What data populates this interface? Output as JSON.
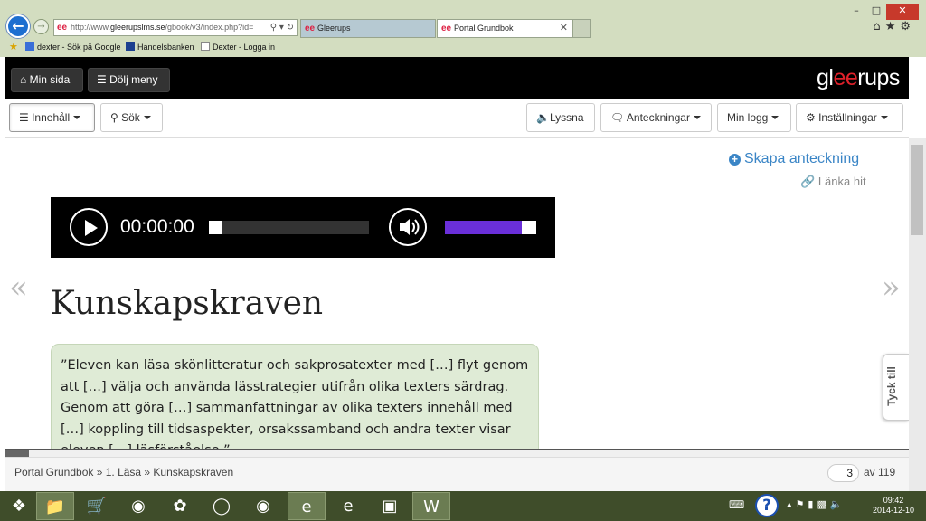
{
  "browser": {
    "url_prefix": "http://www.",
    "url_domain": "gleerupslms.se",
    "url_rest": "/gbook/v3/index.php?id=",
    "tabs": [
      {
        "label": "Gleerups"
      },
      {
        "label": "Portal Grundbok"
      }
    ],
    "favorites": [
      {
        "label": "dexter - Sök på Google"
      },
      {
        "label": "Handelsbanken"
      },
      {
        "label": "Dexter - Logga in"
      }
    ]
  },
  "header": {
    "min_sida": "Min sida",
    "dolj_meny": "Dölj meny",
    "logo_a": "gl",
    "logo_b": "ee",
    "logo_c": "rups"
  },
  "toolbar": {
    "innehall": "Innehåll",
    "sok": "Sök",
    "lyssna": "Lyssna",
    "anteckningar": "Anteckningar",
    "min_logg": "Min logg",
    "installningar": "Inställningar"
  },
  "content": {
    "skapa": "Skapa anteckning",
    "lanka": "Länka hit",
    "player_time": "00:00:00",
    "volume_level": 0.84,
    "title": "Kunskapskraven",
    "quote": "”Eleven kan läsa skönlitteratur och sakprosatexter med […] flyt genom att […] välja och använda lässtrategier utifrån olika texters särdrag. Genom att göra […] sammanfattningar av olika texters innehåll med […] koppling till tidsaspekter, orsakssamband och andra texter visar eleven […] läsförståelse.”",
    "tyck_till": "Tyck till"
  },
  "footer": {
    "crumb": "Portal Grundbok » 1. Läsa » Kunskapskraven",
    "page": "3",
    "total": "av 119"
  },
  "taskbar": {
    "time": "09:42",
    "date": "2014-12-10"
  }
}
